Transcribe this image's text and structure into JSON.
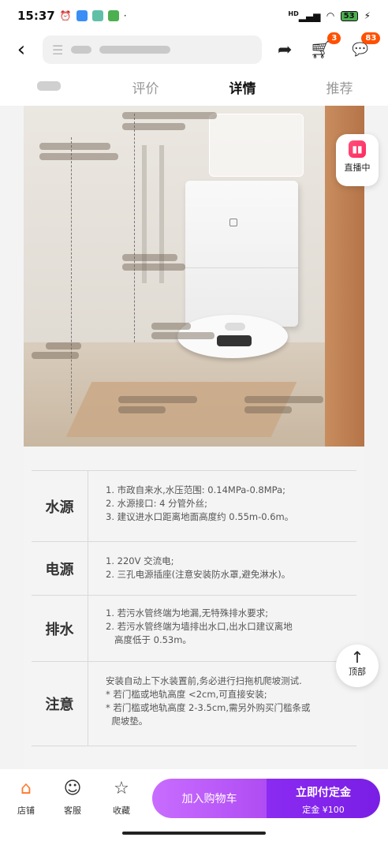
{
  "status_bar": {
    "time": "15:37",
    "network": "HD",
    "battery": "53",
    "charging_symbol": "⚡"
  },
  "header": {
    "back_icon": "‹",
    "menu_icon": "☰",
    "cart_badge": "3",
    "message_badge": "83"
  },
  "tabs": [
    {
      "label": "",
      "active": false
    },
    {
      "label": "评价",
      "active": false
    },
    {
      "label": "详情",
      "active": true
    },
    {
      "label": "推荐",
      "active": false
    }
  ],
  "live_button": {
    "label": "直播中"
  },
  "specs": [
    {
      "label": "水源",
      "lines": [
        "1. 市政自来水,水压范围: 0.14MPa-0.8MPa;",
        "2. 水源接口: 4 分管外丝;",
        "3. 建议进水口距离地面高度约 0.55m-0.6m。"
      ]
    },
    {
      "label": "电源",
      "lines": [
        "1. 220V 交流电;",
        "2. 三孔电源插座(注意安装防水罩,避免淋水)。"
      ]
    },
    {
      "label": "排水",
      "lines": [
        "1. 若污水管终端为地漏,无特殊排水要求;",
        "2. 若污水管终端为墙排出水口,出水口建议离地",
        "   高度低于 0.53m。"
      ]
    },
    {
      "label": "注意",
      "lines": [
        "安装自动上下水装置前,务必进行扫拖机爬坡测试.",
        "* 若门槛或地轨高度 <2cm,可直接安装;",
        "* 若门槛或地轨高度 2-3.5cm,需另外购买门槛条或",
        "  爬坡垫。"
      ]
    }
  ],
  "to_top": {
    "label": "顶部"
  },
  "bottom": {
    "shop_label": "店铺",
    "service_label": "客服",
    "favorite_label": "收藏",
    "cart_button": "加入购物车",
    "buy_button": "立即付定金",
    "deposit_text": "定金 ¥100"
  },
  "colors": {
    "accent": "#ff5000",
    "cart_button": "#b04cf3",
    "buy_button": "#7a1ee5"
  }
}
